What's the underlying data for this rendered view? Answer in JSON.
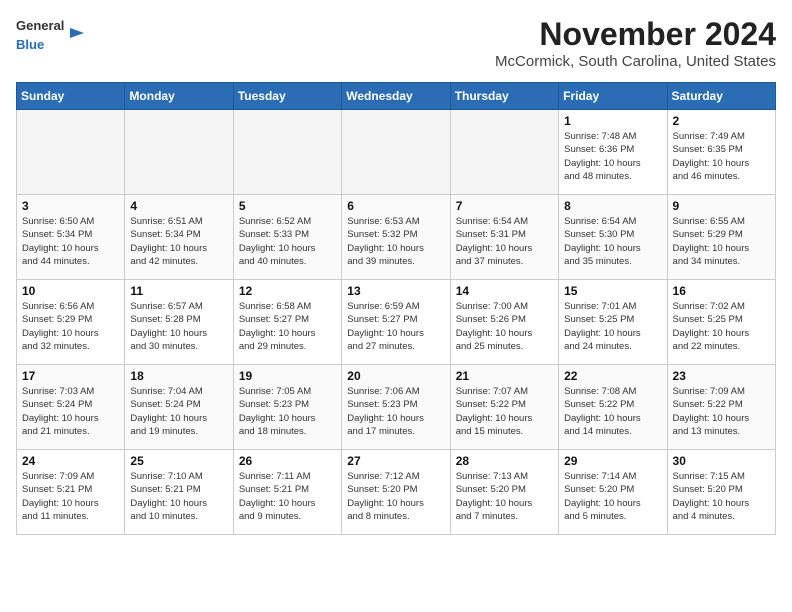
{
  "header": {
    "logo_line1": "General",
    "logo_line2": "Blue",
    "month": "November 2024",
    "location": "McCormick, South Carolina, United States"
  },
  "days_of_week": [
    "Sunday",
    "Monday",
    "Tuesday",
    "Wednesday",
    "Thursday",
    "Friday",
    "Saturday"
  ],
  "weeks": [
    [
      {
        "day": "",
        "info": ""
      },
      {
        "day": "",
        "info": ""
      },
      {
        "day": "",
        "info": ""
      },
      {
        "day": "",
        "info": ""
      },
      {
        "day": "",
        "info": ""
      },
      {
        "day": "1",
        "info": "Sunrise: 7:48 AM\nSunset: 6:36 PM\nDaylight: 10 hours\nand 48 minutes."
      },
      {
        "day": "2",
        "info": "Sunrise: 7:49 AM\nSunset: 6:35 PM\nDaylight: 10 hours\nand 46 minutes."
      }
    ],
    [
      {
        "day": "3",
        "info": "Sunrise: 6:50 AM\nSunset: 5:34 PM\nDaylight: 10 hours\nand 44 minutes."
      },
      {
        "day": "4",
        "info": "Sunrise: 6:51 AM\nSunset: 5:34 PM\nDaylight: 10 hours\nand 42 minutes."
      },
      {
        "day": "5",
        "info": "Sunrise: 6:52 AM\nSunset: 5:33 PM\nDaylight: 10 hours\nand 40 minutes."
      },
      {
        "day": "6",
        "info": "Sunrise: 6:53 AM\nSunset: 5:32 PM\nDaylight: 10 hours\nand 39 minutes."
      },
      {
        "day": "7",
        "info": "Sunrise: 6:54 AM\nSunset: 5:31 PM\nDaylight: 10 hours\nand 37 minutes."
      },
      {
        "day": "8",
        "info": "Sunrise: 6:54 AM\nSunset: 5:30 PM\nDaylight: 10 hours\nand 35 minutes."
      },
      {
        "day": "9",
        "info": "Sunrise: 6:55 AM\nSunset: 5:29 PM\nDaylight: 10 hours\nand 34 minutes."
      }
    ],
    [
      {
        "day": "10",
        "info": "Sunrise: 6:56 AM\nSunset: 5:29 PM\nDaylight: 10 hours\nand 32 minutes."
      },
      {
        "day": "11",
        "info": "Sunrise: 6:57 AM\nSunset: 5:28 PM\nDaylight: 10 hours\nand 30 minutes."
      },
      {
        "day": "12",
        "info": "Sunrise: 6:58 AM\nSunset: 5:27 PM\nDaylight: 10 hours\nand 29 minutes."
      },
      {
        "day": "13",
        "info": "Sunrise: 6:59 AM\nSunset: 5:27 PM\nDaylight: 10 hours\nand 27 minutes."
      },
      {
        "day": "14",
        "info": "Sunrise: 7:00 AM\nSunset: 5:26 PM\nDaylight: 10 hours\nand 25 minutes."
      },
      {
        "day": "15",
        "info": "Sunrise: 7:01 AM\nSunset: 5:25 PM\nDaylight: 10 hours\nand 24 minutes."
      },
      {
        "day": "16",
        "info": "Sunrise: 7:02 AM\nSunset: 5:25 PM\nDaylight: 10 hours\nand 22 minutes."
      }
    ],
    [
      {
        "day": "17",
        "info": "Sunrise: 7:03 AM\nSunset: 5:24 PM\nDaylight: 10 hours\nand 21 minutes."
      },
      {
        "day": "18",
        "info": "Sunrise: 7:04 AM\nSunset: 5:24 PM\nDaylight: 10 hours\nand 19 minutes."
      },
      {
        "day": "19",
        "info": "Sunrise: 7:05 AM\nSunset: 5:23 PM\nDaylight: 10 hours\nand 18 minutes."
      },
      {
        "day": "20",
        "info": "Sunrise: 7:06 AM\nSunset: 5:23 PM\nDaylight: 10 hours\nand 17 minutes."
      },
      {
        "day": "21",
        "info": "Sunrise: 7:07 AM\nSunset: 5:22 PM\nDaylight: 10 hours\nand 15 minutes."
      },
      {
        "day": "22",
        "info": "Sunrise: 7:08 AM\nSunset: 5:22 PM\nDaylight: 10 hours\nand 14 minutes."
      },
      {
        "day": "23",
        "info": "Sunrise: 7:09 AM\nSunset: 5:22 PM\nDaylight: 10 hours\nand 13 minutes."
      }
    ],
    [
      {
        "day": "24",
        "info": "Sunrise: 7:09 AM\nSunset: 5:21 PM\nDaylight: 10 hours\nand 11 minutes."
      },
      {
        "day": "25",
        "info": "Sunrise: 7:10 AM\nSunset: 5:21 PM\nDaylight: 10 hours\nand 10 minutes."
      },
      {
        "day": "26",
        "info": "Sunrise: 7:11 AM\nSunset: 5:21 PM\nDaylight: 10 hours\nand 9 minutes."
      },
      {
        "day": "27",
        "info": "Sunrise: 7:12 AM\nSunset: 5:20 PM\nDaylight: 10 hours\nand 8 minutes."
      },
      {
        "day": "28",
        "info": "Sunrise: 7:13 AM\nSunset: 5:20 PM\nDaylight: 10 hours\nand 7 minutes."
      },
      {
        "day": "29",
        "info": "Sunrise: 7:14 AM\nSunset: 5:20 PM\nDaylight: 10 hours\nand 5 minutes."
      },
      {
        "day": "30",
        "info": "Sunrise: 7:15 AM\nSunset: 5:20 PM\nDaylight: 10 hours\nand 4 minutes."
      }
    ]
  ]
}
